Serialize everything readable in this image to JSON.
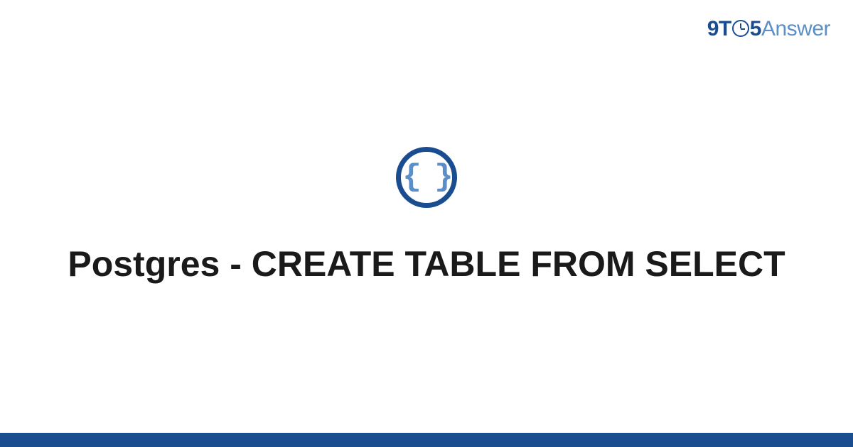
{
  "logo": {
    "part1": "9",
    "part2": "T",
    "part3": "5",
    "part4": "Answer"
  },
  "icon": {
    "name": "code-braces-icon",
    "glyph": "{ }"
  },
  "title": "Postgres - CREATE TABLE FROM SELECT",
  "colors": {
    "primary": "#1a4d8f",
    "secondary": "#5a8fc7"
  }
}
